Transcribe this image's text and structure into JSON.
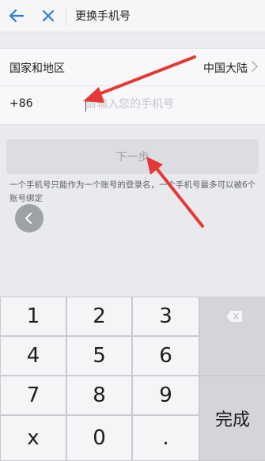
{
  "header": {
    "title": "更换手机号"
  },
  "form": {
    "region_label": "国家和地区",
    "region_value": "中国大陆",
    "country_code": "+86",
    "phone_placeholder": "请输入您的手机号",
    "phone_value": ""
  },
  "next_button_label": "下一步",
  "hint": "一个手机号只能作为一个账号的登录名，一个手机号最多可以被6个账号绑定",
  "annotation_color": "#e53935",
  "keyboard": {
    "keys": [
      "1",
      "2",
      "3",
      "4",
      "5",
      "6",
      "7",
      "8",
      "9",
      "x",
      "0",
      "."
    ],
    "done_label": "完成"
  },
  "colors": {
    "accent": "#2a7fd6",
    "annotation": "#e53935"
  }
}
